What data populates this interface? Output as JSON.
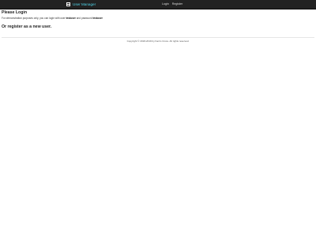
{
  "navbar": {
    "brand": {
      "icon": "app-logo-icon",
      "label": "User Manager"
    },
    "links": [
      {
        "label": "Login"
      },
      {
        "label": "Register"
      }
    ]
  },
  "main": {
    "title": "Please Login",
    "demo_prefix": "For demonstration purposes only, you can login with user ",
    "demo_user": "testuser",
    "demo_middle": " and password ",
    "demo_password": "testuser",
    "register_prefix": "Or ",
    "register_link": "register",
    "register_suffix": " as a new user."
  },
  "footer": {
    "text": "Copyright © 2018-2019 by Karim Cross. All rights reserved."
  }
}
